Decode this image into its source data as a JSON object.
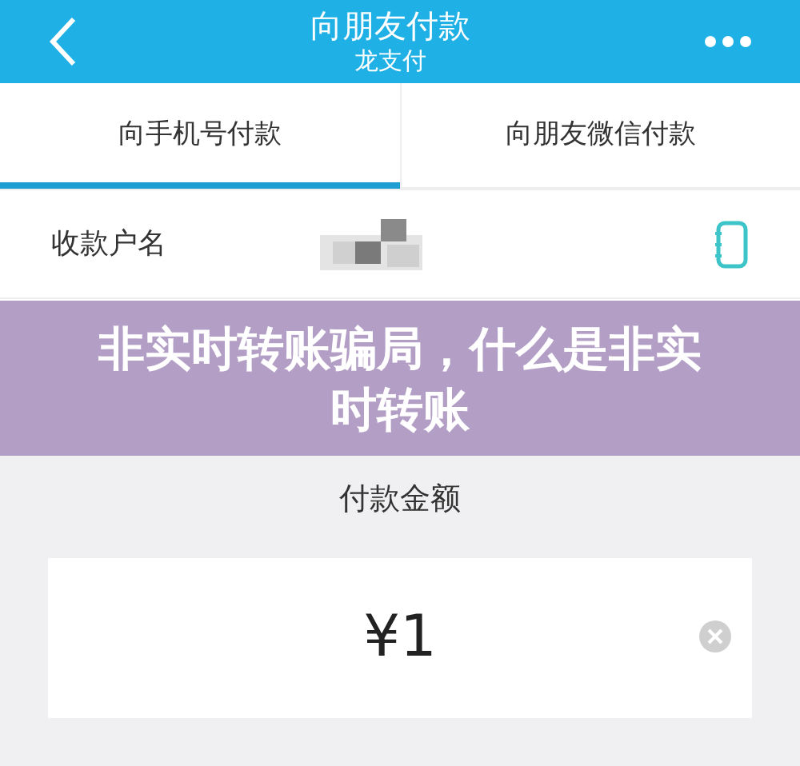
{
  "header": {
    "title": "向朋友付款",
    "subtitle": "龙支付"
  },
  "tabs": [
    {
      "label": "向手机号付款",
      "selected": true
    },
    {
      "label": "向朋友微信付款",
      "selected": false
    }
  ],
  "payee": {
    "label": "收款户名"
  },
  "banner": {
    "title": "非实时转账骗局，什么是非实时转账"
  },
  "amount": {
    "label": "付款金额",
    "value": "¥1"
  }
}
